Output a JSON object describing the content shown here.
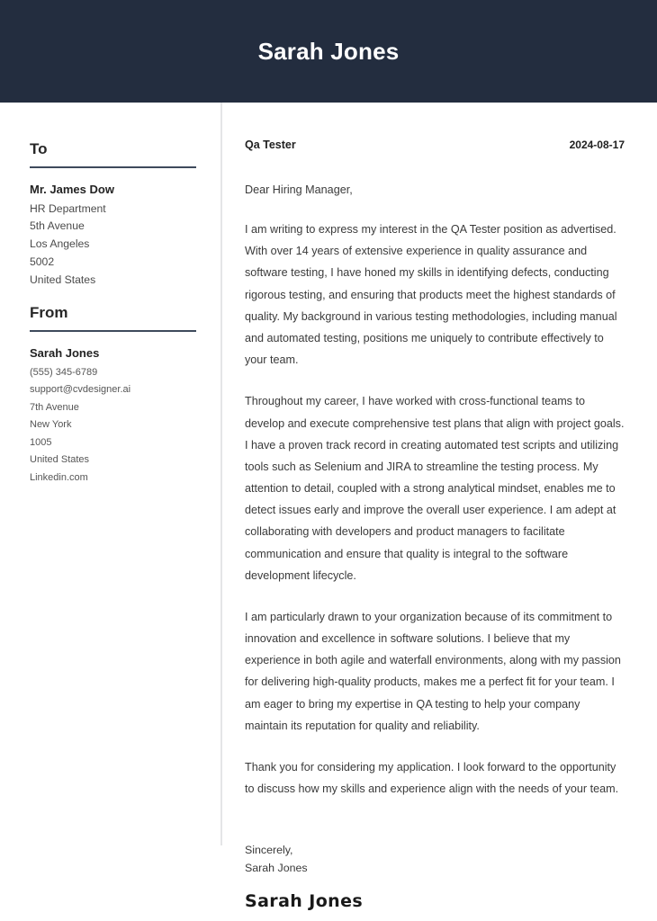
{
  "header": {
    "name": "Sarah Jones"
  },
  "sidebar": {
    "to": {
      "heading": "To",
      "name": "Mr. James Dow",
      "lines": [
        "HR Department",
        "5th Avenue",
        "Los Angeles",
        "5002",
        "United States"
      ]
    },
    "from": {
      "heading": "From",
      "name": "Sarah Jones",
      "lines": [
        "(555) 345-6789",
        "support@cvdesigner.ai",
        "7th Avenue",
        "New York",
        "1005",
        "United States",
        "Linkedin.com"
      ]
    }
  },
  "letter": {
    "job_title": "Qa Tester",
    "date": "2024-08-17",
    "salutation": "Dear Hiring Manager,",
    "paragraphs": [
      "I am writing to express my interest in the QA Tester position as advertised. With over 14 years of extensive experience in quality assurance and software testing, I have honed my skills in identifying defects, conducting rigorous testing, and ensuring that products meet the highest standards of quality. My background in various testing methodologies, including manual and automated testing, positions me uniquely to contribute effectively to your team.",
      "Throughout my career, I have worked with cross-functional teams to develop and execute comprehensive test plans that align with project goals. I have a proven track record in creating automated test scripts and utilizing tools such as Selenium and JIRA to streamline the testing process. My attention to detail, coupled with a strong analytical mindset, enables me to detect issues early and improve the overall user experience. I am adept at collaborating with developers and product managers to facilitate communication and ensure that quality is integral to the software development lifecycle.",
      "I am particularly drawn to your organization because of its commitment to innovation and excellence in software solutions. I believe that my experience in both agile and waterfall environments, along with my passion for delivering high-quality products, makes me a perfect fit for your team. I am eager to bring my expertise in QA testing to help your company maintain its reputation for quality and reliability.",
      "Thank you for considering my application. I look forward to the opportunity to discuss how my skills and experience align with the needs of your team."
    ],
    "closing": "Sincerely,",
    "closing_name": "Sarah Jones",
    "signature": "Sarah Jones"
  },
  "colors": {
    "header_background": "#232d3f",
    "rule": "#3e4a5c",
    "divider": "#e4e5e7",
    "body_text": "#3a3a3a"
  }
}
